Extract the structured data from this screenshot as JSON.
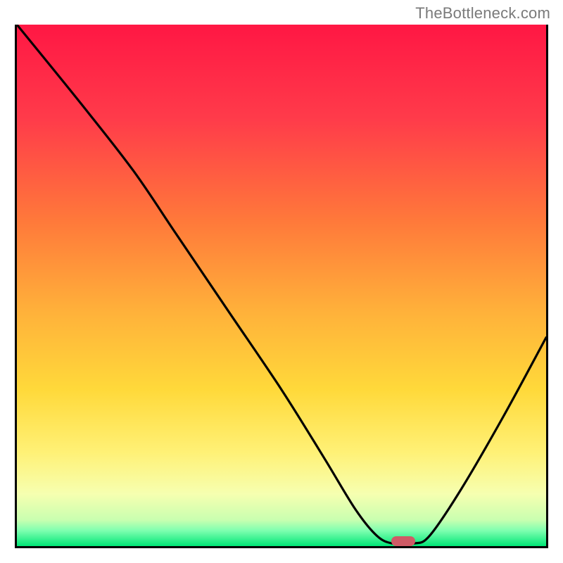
{
  "attribution": "TheBottleneck.com",
  "chart_data": {
    "type": "line",
    "title": "",
    "xlabel": "",
    "ylabel": "",
    "xlim": [
      0,
      100
    ],
    "ylim": [
      0,
      100
    ],
    "curve": [
      {
        "x": 0,
        "y": 100
      },
      {
        "x": 12,
        "y": 85
      },
      {
        "x": 22,
        "y": 72
      },
      {
        "x": 30,
        "y": 60
      },
      {
        "x": 40,
        "y": 45
      },
      {
        "x": 50,
        "y": 30
      },
      {
        "x": 58,
        "y": 17
      },
      {
        "x": 64,
        "y": 7
      },
      {
        "x": 68,
        "y": 2
      },
      {
        "x": 71,
        "y": 0.5
      },
      {
        "x": 75,
        "y": 0.5
      },
      {
        "x": 78,
        "y": 2
      },
      {
        "x": 84,
        "y": 11
      },
      {
        "x": 92,
        "y": 25
      },
      {
        "x": 100,
        "y": 40
      }
    ],
    "marker": {
      "x": 73,
      "y": 1
    },
    "gradient_stops": [
      {
        "offset": 0,
        "color": "#ff1744"
      },
      {
        "offset": 18,
        "color": "#ff3b4a"
      },
      {
        "offset": 38,
        "color": "#ff7a3a"
      },
      {
        "offset": 55,
        "color": "#ffb13a"
      },
      {
        "offset": 70,
        "color": "#ffd93a"
      },
      {
        "offset": 82,
        "color": "#fff176"
      },
      {
        "offset": 90,
        "color": "#f6ffb0"
      },
      {
        "offset": 95,
        "color": "#c9ffb0"
      },
      {
        "offset": 97,
        "color": "#7fffb0"
      },
      {
        "offset": 100,
        "color": "#00e676"
      }
    ]
  }
}
